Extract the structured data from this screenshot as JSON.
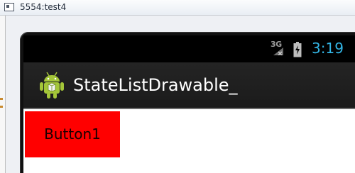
{
  "window": {
    "title": "5554:test4"
  },
  "status_bar": {
    "network_label": "3G",
    "time": "3:19",
    "time_color": "#33b5e5",
    "icons": [
      "signal-icon",
      "battery-charging-icon"
    ]
  },
  "action_bar": {
    "title": "StateListDrawable_",
    "icon": "android-robot-icon"
  },
  "content": {
    "button1_label": "Button1",
    "button1_color": "#ff0000"
  }
}
